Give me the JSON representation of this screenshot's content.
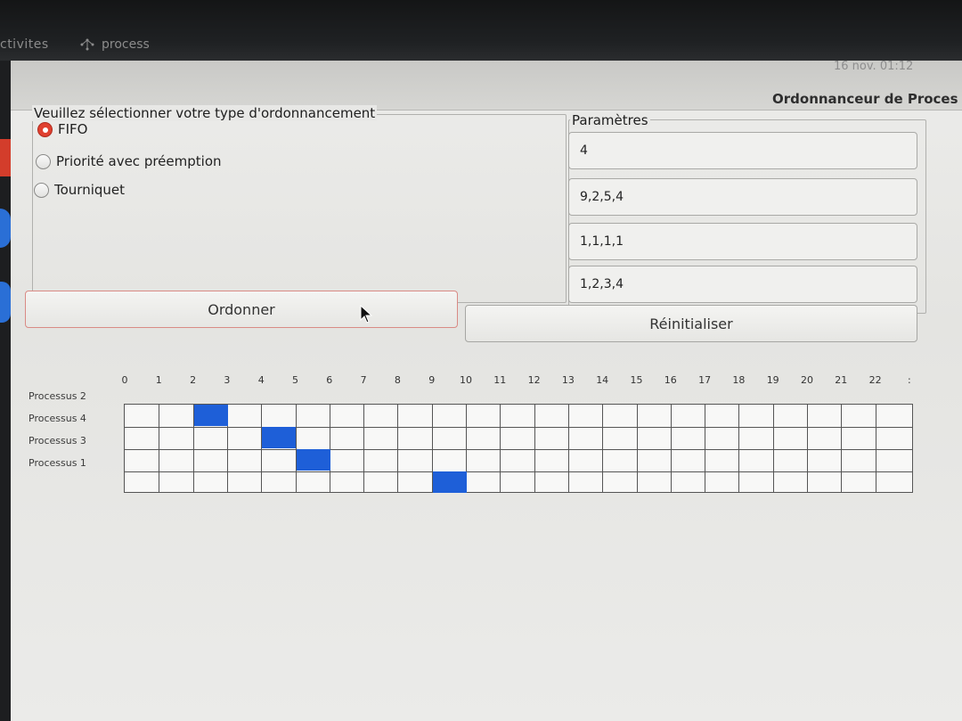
{
  "system_bar": {
    "activities": "ctivites",
    "app_name": "process",
    "clock": "16 nov. 01:12"
  },
  "window": {
    "title": "Ordonnanceur de Proces"
  },
  "scheduling": {
    "label": "Veuillez sélectionner votre type d'ordonnancement",
    "options": [
      {
        "label": "FIFO",
        "selected": true
      },
      {
        "label": "Priorité avec préemption",
        "selected": false
      },
      {
        "label": "Tourniquet",
        "selected": false
      }
    ]
  },
  "parameters": {
    "label": "Paramètres",
    "entries": [
      "4",
      "9,2,5,4",
      "1,1,1,1",
      "1,2,3,4"
    ]
  },
  "buttons": {
    "order": "Ordonner",
    "reset": "Réinitialiser"
  },
  "gantt": {
    "ticks": [
      "0",
      "1",
      "2",
      "3",
      "4",
      "5",
      "6",
      "7",
      "8",
      "9",
      "10",
      "11",
      "12",
      "13",
      "14",
      "15",
      "16",
      "17",
      "18",
      "19",
      "20",
      "21",
      "22",
      ":"
    ],
    "rows": [
      "Processus 2",
      "Processus 4",
      "Processus 3",
      "Processus 1"
    ],
    "filled_cells": [
      {
        "row": 0,
        "col": 2
      },
      {
        "row": 1,
        "col": 4
      },
      {
        "row": 2,
        "col": 5
      },
      {
        "row": 3,
        "col": 9
      }
    ],
    "fill_color": "#1e5fd8"
  }
}
